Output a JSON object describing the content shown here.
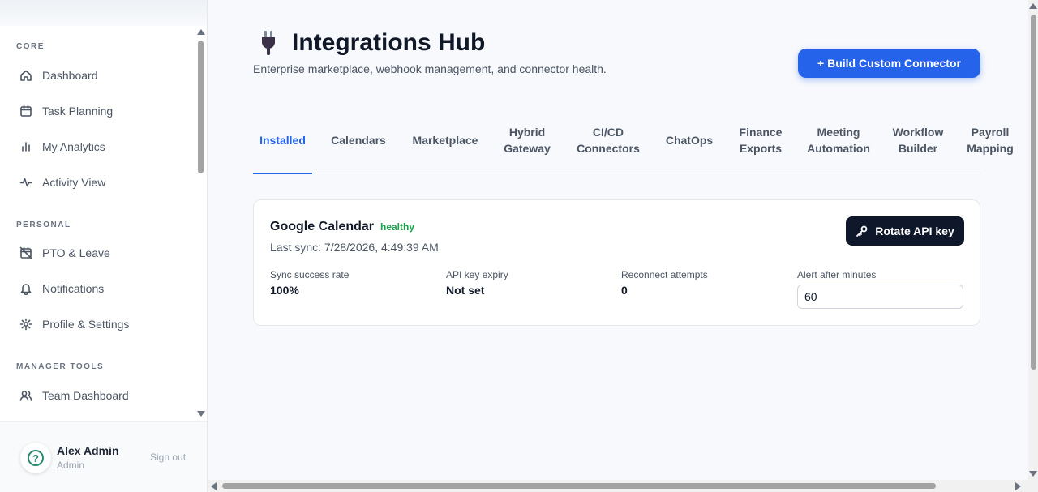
{
  "sidebar": {
    "sections": [
      {
        "label": "CORE"
      },
      {
        "label": "PERSONAL"
      },
      {
        "label": "MANAGER TOOLS"
      }
    ],
    "items": [
      {
        "label": "Dashboard",
        "icon": "home-icon"
      },
      {
        "label": "Task Planning",
        "icon": "calendar-icon"
      },
      {
        "label": "My Analytics",
        "icon": "bar-chart-icon"
      },
      {
        "label": "Activity View",
        "icon": "activity-icon"
      },
      {
        "label": "PTO & Leave",
        "icon": "calendar-off-icon"
      },
      {
        "label": "Notifications",
        "icon": "bell-icon"
      },
      {
        "label": "Profile & Settings",
        "icon": "gear-icon"
      },
      {
        "label": "Team Dashboard",
        "icon": "users-icon"
      }
    ],
    "user": {
      "name": "Alex Admin",
      "role": "Admin",
      "avatar_glyph": "?",
      "sign_out": "Sign out"
    }
  },
  "header": {
    "title": "Integrations Hub",
    "subtitle": "Enterprise marketplace, webhook management, and connector health.",
    "build_button": "+ Build Custom Connector",
    "icon": "plug-icon"
  },
  "tabs": [
    {
      "line1": "Installed",
      "line2": "",
      "active": true
    },
    {
      "line1": "Calendars",
      "line2": ""
    },
    {
      "line1": "Marketplace",
      "line2": ""
    },
    {
      "line1": "Hybrid",
      "line2": "Gateway"
    },
    {
      "line1": "CI/CD",
      "line2": "Connectors"
    },
    {
      "line1": "ChatOps",
      "line2": ""
    },
    {
      "line1": "Finance",
      "line2": "Exports"
    },
    {
      "line1": "Meeting",
      "line2": "Automation"
    },
    {
      "line1": "Workflow",
      "line2": "Builder"
    },
    {
      "line1": "Payroll",
      "line2": "Mapping"
    }
  ],
  "integration": {
    "name": "Google Calendar",
    "status": "healthy",
    "last_sync": "Last sync: 7/28/2026, 4:49:39 AM",
    "rotate_button": "Rotate API key",
    "metrics": [
      {
        "label": "Sync success rate",
        "value": "100%"
      },
      {
        "label": "API key expiry",
        "value": "Not set"
      },
      {
        "label": "Reconnect attempts",
        "value": "0"
      }
    ],
    "alert": {
      "label": "Alert after minutes",
      "value": "60"
    }
  },
  "colors": {
    "accent": "#2563eb",
    "status_healthy": "#16a34a",
    "dark_button": "#0f172a"
  }
}
